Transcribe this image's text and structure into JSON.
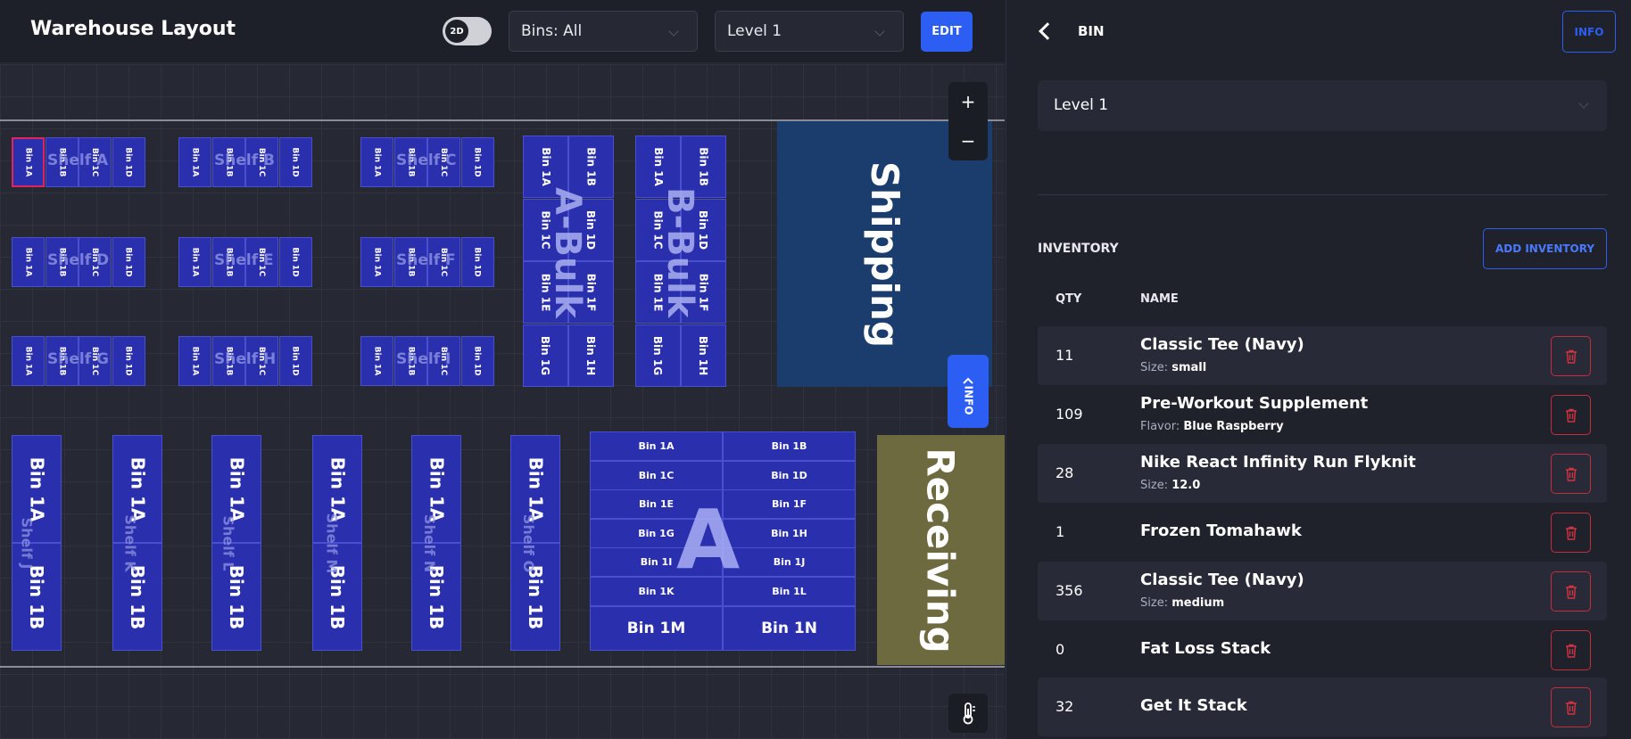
{
  "header": {
    "title": "Warehouse Layout",
    "toggle_label": "2D",
    "bins_filter": "Bins: All",
    "level_select": "Level 1",
    "edit_label": "EDIT"
  },
  "map": {
    "zoom_in": "+",
    "zoom_out": "−",
    "info_tab": "INFO",
    "shelves": {
      "a": "Shelf A",
      "b": "Shelf B",
      "c": "Shelf C",
      "d": "Shelf D",
      "e": "Shelf E",
      "f": "Shelf F",
      "g": "Shelf G",
      "h": "Shelf H",
      "i": "Shelf I"
    },
    "small_bins": [
      "Bin 1A",
      "Bin 1B",
      "Bin 1C",
      "Bin 1D"
    ],
    "bulk_bins": [
      "Bin 1A",
      "Bin 1B",
      "Bin 1C",
      "Bin 1D",
      "Bin 1E",
      "Bin 1F",
      "Bin 1G",
      "Bin 1H"
    ],
    "bulk_a_label": "A-Bulk",
    "bulk_b_label": "B-Bulk",
    "tall_shelf_labels": [
      "Shelf J",
      "Shelf K",
      "Shelf L",
      "Shelf M",
      "Shelf N",
      "Shelf O"
    ],
    "tall_bins": [
      "Bin 1A",
      "Bin 1B"
    ],
    "grid_a_label": "A",
    "grid_a_bins": [
      "Bin 1A",
      "Bin 1B",
      "Bin 1C",
      "Bin 1D",
      "Bin 1E",
      "Bin 1F",
      "Bin 1G",
      "Bin 1H",
      "Bin 1I",
      "Bin 1J",
      "Bin 1K",
      "Bin 1L"
    ],
    "grid_a_bottom": [
      "Bin 1M",
      "Bin 1N"
    ],
    "zones": {
      "shipping": "Shipping",
      "receiving": "Receiving"
    },
    "colors": {
      "bin": "#2a2fae",
      "shipping": "#1b3d6e",
      "receiving": "#6e6a3f",
      "selected": "#e0245e"
    }
  },
  "panel": {
    "title": "BIN",
    "info_label": "INFO",
    "level": "Level 1",
    "inventory_title": "INVENTORY",
    "add_inventory_label": "ADD INVENTORY",
    "col_qty": "QTY",
    "col_name": "NAME",
    "items": [
      {
        "qty": "11",
        "name": "Classic Tee (Navy)",
        "attr_key": "Size:",
        "attr_val": "small"
      },
      {
        "qty": "109",
        "name": "Pre-Workout Supplement",
        "attr_key": "Flavor:",
        "attr_val": "Blue Raspberry"
      },
      {
        "qty": "28",
        "name": "Nike React Infinity Run Flyknit",
        "attr_key": "Size:",
        "attr_val": "12.0"
      },
      {
        "qty": "1",
        "name": "Frozen Tomahawk",
        "attr_key": "",
        "attr_val": ""
      },
      {
        "qty": "356",
        "name": "Classic Tee (Navy)",
        "attr_key": "Size:",
        "attr_val": "medium"
      },
      {
        "qty": "0",
        "name": "Fat Loss Stack",
        "attr_key": "",
        "attr_val": ""
      },
      {
        "qty": "32",
        "name": "Get It Stack",
        "attr_key": "",
        "attr_val": ""
      }
    ]
  },
  "icons": [
    "chevron-down-icon",
    "chevron-left-icon",
    "trash-icon",
    "thermometer-icon",
    "plus-icon",
    "minus-icon"
  ]
}
